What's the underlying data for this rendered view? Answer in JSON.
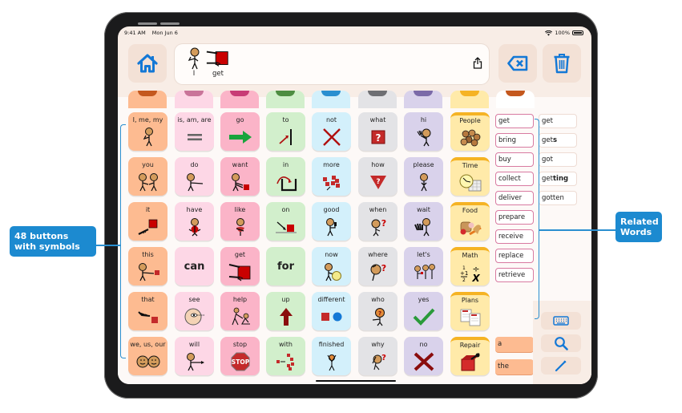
{
  "status_bar": {
    "time": "9:41 AM",
    "date": "Mon Jun 6",
    "battery": "100%"
  },
  "header": {
    "home_icon": "house-icon",
    "message": [
      {
        "word": "I",
        "symbol": "person-pointing-self"
      },
      {
        "word": "get",
        "symbol": "hands-grabbing-red-square"
      }
    ],
    "share_icon": "share-icon",
    "backspace_icon": "backspace-icon",
    "clear_icon": "trash-icon"
  },
  "colors": {
    "pronoun": "#fdbb91",
    "verb_light": "#fdd7e6",
    "verb": "#fbb4c8",
    "preposition": "#d2efcc",
    "adjective": "#d3f0fb",
    "question": "#e3e3e6",
    "social": "#d9d2eb",
    "folder": "#ffeaa9",
    "accent": "#1c8ad0"
  },
  "tabs": [
    {
      "color": "#fdbb91",
      "notch": "#c4581e"
    },
    {
      "color": "#fdd7e6",
      "notch": "#c97499"
    },
    {
      "color": "#fbb4c8",
      "notch": "#c83c76"
    },
    {
      "color": "#d2efcc",
      "notch": "#4e8d42"
    },
    {
      "color": "#d3f0fb",
      "notch": "#2a8fd0"
    },
    {
      "color": "#e3e3e6",
      "notch": "#6e6f73"
    },
    {
      "color": "#d9d2eb",
      "notch": "#7b6aa8"
    },
    {
      "color": "#ffeaa9",
      "notch": "#f5b324"
    },
    {
      "color": "#ffffff",
      "notch": "#c4581e"
    }
  ],
  "grid": [
    [
      {
        "label": "I, me, my",
        "type": "pronoun",
        "symbol": "person-self"
      },
      {
        "label": "is, am, are",
        "type": "verb_light",
        "symbol": "equals"
      },
      {
        "label": "go",
        "type": "verb",
        "symbol": "green-arrow"
      },
      {
        "label": "to",
        "type": "preposition",
        "symbol": "arrow-to-line"
      },
      {
        "label": "not",
        "type": "adjective",
        "symbol": "red-x"
      },
      {
        "label": "what",
        "type": "question",
        "symbol": "question-box"
      },
      {
        "label": "hi",
        "type": "social",
        "symbol": "person-waving"
      },
      {
        "label": "People",
        "type": "folder",
        "symbol": "group-of-people"
      }
    ],
    [
      {
        "label": "you",
        "type": "pronoun",
        "symbol": "two-people"
      },
      {
        "label": "do",
        "type": "verb_light",
        "symbol": "person-pointing"
      },
      {
        "label": "want",
        "type": "verb",
        "symbol": "person-reaching"
      },
      {
        "label": "in",
        "type": "preposition",
        "symbol": "arrow-into-box"
      },
      {
        "label": "more",
        "type": "adjective",
        "symbol": "red-blocks"
      },
      {
        "label": "how",
        "type": "question",
        "symbol": "question-triangle"
      },
      {
        "label": "please",
        "type": "social",
        "symbol": "person-please"
      },
      {
        "label": "Time",
        "type": "folder",
        "symbol": "clock-calendar"
      }
    ],
    [
      {
        "label": "it",
        "type": "pronoun",
        "symbol": "hand-pointing-square"
      },
      {
        "label": "have",
        "type": "verb_light",
        "symbol": "person-holding"
      },
      {
        "label": "like",
        "type": "verb",
        "symbol": "person-hugging"
      },
      {
        "label": "on",
        "type": "preposition",
        "symbol": "arrow-on-surface"
      },
      {
        "label": "good",
        "type": "adjective",
        "symbol": "thumbs-up-person"
      },
      {
        "label": "when",
        "type": "question",
        "symbol": "person-question"
      },
      {
        "label": "wait",
        "type": "social",
        "symbol": "hands-wait"
      },
      {
        "label": "Food",
        "type": "folder",
        "symbol": "food"
      }
    ],
    [
      {
        "label": "this",
        "type": "pronoun",
        "symbol": "person-pointing-square"
      },
      {
        "label": "can",
        "type": "verb_light",
        "symbol": "",
        "big": true
      },
      {
        "label": "get",
        "type": "verb",
        "symbol": "hands-grabbing-red-square"
      },
      {
        "label": "for",
        "type": "preposition",
        "symbol": "",
        "big": true
      },
      {
        "label": "now",
        "type": "adjective",
        "symbol": "person-clock"
      },
      {
        "label": "where",
        "type": "question",
        "symbol": "person-looking-question"
      },
      {
        "label": "let's",
        "type": "social",
        "symbol": "group-walking"
      },
      {
        "label": "Math",
        "type": "folder",
        "symbol": "math-symbols"
      }
    ],
    [
      {
        "label": "that",
        "type": "pronoun",
        "symbol": "hand-pointing-far"
      },
      {
        "label": "see",
        "type": "verb_light",
        "symbol": "eye-face"
      },
      {
        "label": "help",
        "type": "verb",
        "symbol": "people-helping"
      },
      {
        "label": "up",
        "type": "preposition",
        "symbol": "up-arrow"
      },
      {
        "label": "different",
        "type": "adjective",
        "symbol": "square-circle"
      },
      {
        "label": "who",
        "type": "question",
        "symbol": "person-who"
      },
      {
        "label": "yes",
        "type": "social",
        "symbol": "green-check"
      },
      {
        "label": "Plans",
        "type": "folder",
        "symbol": "plan-sheets"
      }
    ],
    [
      {
        "label": "we, us, our",
        "type": "pronoun",
        "symbol": "two-faces"
      },
      {
        "label": "will",
        "type": "verb_light",
        "symbol": "person-pointing-forward"
      },
      {
        "label": "stop",
        "type": "verb",
        "symbol": "stop-sign"
      },
      {
        "label": "with",
        "type": "preposition",
        "symbol": "blocks-together"
      },
      {
        "label": "finished",
        "type": "adjective",
        "symbol": "person-arms-up"
      },
      {
        "label": "why",
        "type": "question",
        "symbol": "person-thinking"
      },
      {
        "label": "no",
        "type": "social",
        "symbol": "red-x-dark"
      },
      {
        "label": "Repair",
        "type": "folder",
        "symbol": "toolbox"
      }
    ]
  ],
  "related_words": [
    "get",
    "bring",
    "buy",
    "collect",
    "deliver",
    "prepare",
    "receive",
    "replace",
    "retrieve"
  ],
  "word_forms": [
    {
      "base": "get",
      "suffix": ""
    },
    {
      "base": "get",
      "suffix": "s"
    },
    {
      "base": "got",
      "suffix": ""
    },
    {
      "base": "get",
      "suffix": "ting"
    },
    {
      "base": "gotten",
      "suffix": ""
    }
  ],
  "articles": [
    "a",
    "the"
  ],
  "tools": [
    {
      "icon": "keyboard-icon"
    },
    {
      "icon": "search-icon"
    },
    {
      "icon": "pencil-icon"
    }
  ],
  "callouts": {
    "left": "48 buttons with symbols",
    "right": "Related Words"
  }
}
